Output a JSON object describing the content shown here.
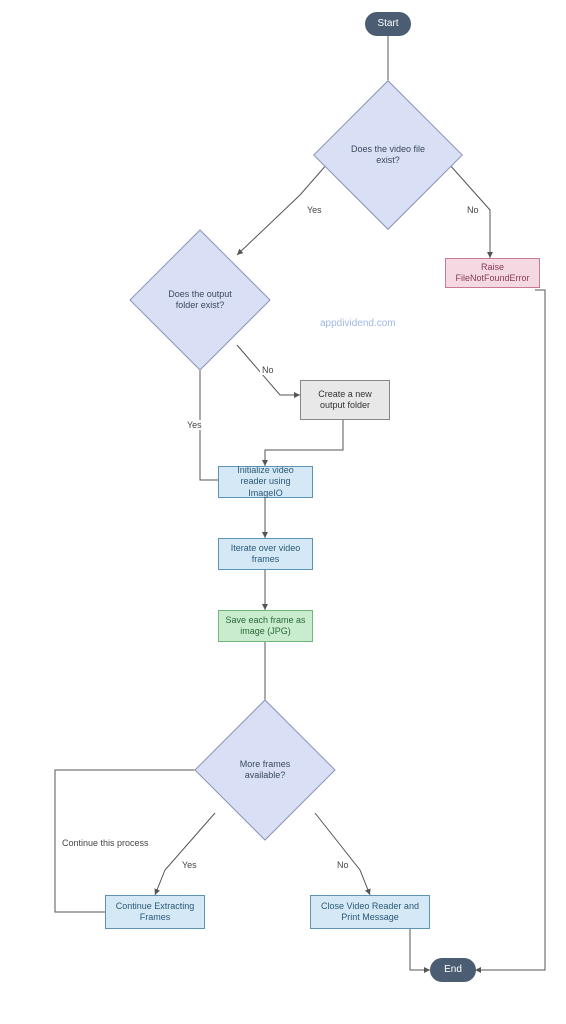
{
  "nodes": {
    "start": "Start",
    "end": "End",
    "decision_video_exists": "Does the video file exist?",
    "decision_output_exists": "Does the output folder exist?",
    "decision_more_frames": "More frames available?",
    "create_folder": "Create a new output folder",
    "raise_error": "Raise FileNotFoundError",
    "init_reader": "Initialize video reader using ImageIO",
    "iterate_frames": "Iterate over video frames",
    "save_frame": "Save each frame as image (JPG)",
    "continue_extract": "Continue Extracting Frames",
    "close_reader": "Close Video Reader and Print Message"
  },
  "edges": {
    "yes1": "Yes",
    "no1": "No",
    "yes2": "Yes",
    "no2": "No",
    "yes3": "Yes",
    "no3": "No",
    "continue_process": "Continue this process"
  },
  "watermark": "appdividend.com",
  "colors": {
    "terminator": "#4a5d73",
    "decision": "#d9dff5",
    "process_blue": "#d4e8f5",
    "process_green": "#c9ebce",
    "process_pink": "#f5d9e2",
    "process_gray": "#e8e8e8"
  },
  "chart_data": {
    "type": "flowchart",
    "nodes": [
      {
        "id": "start",
        "type": "terminator",
        "label": "Start"
      },
      {
        "id": "d1",
        "type": "decision",
        "label": "Does the video file exist?"
      },
      {
        "id": "d2",
        "type": "decision",
        "label": "Does the output folder exist?"
      },
      {
        "id": "err",
        "type": "process",
        "label": "Raise FileNotFoundError"
      },
      {
        "id": "mkfolder",
        "type": "process",
        "label": "Create a new output folder"
      },
      {
        "id": "init",
        "type": "process",
        "label": "Initialize video reader using ImageIO"
      },
      {
        "id": "iter",
        "type": "process",
        "label": "Iterate over video frames"
      },
      {
        "id": "save",
        "type": "process",
        "label": "Save each frame as image (JPG)"
      },
      {
        "id": "d3",
        "type": "decision",
        "label": "More frames available?"
      },
      {
        "id": "cont",
        "type": "process",
        "label": "Continue Extracting Frames"
      },
      {
        "id": "close",
        "type": "process",
        "label": "Close Video Reader and Print Message"
      },
      {
        "id": "end",
        "type": "terminator",
        "label": "End"
      }
    ],
    "edges": [
      {
        "from": "start",
        "to": "d1"
      },
      {
        "from": "d1",
        "to": "d2",
        "label": "Yes"
      },
      {
        "from": "d1",
        "to": "err",
        "label": "No"
      },
      {
        "from": "d2",
        "to": "init",
        "label": "Yes"
      },
      {
        "from": "d2",
        "to": "mkfolder",
        "label": "No"
      },
      {
        "from": "mkfolder",
        "to": "init"
      },
      {
        "from": "init",
        "to": "iter"
      },
      {
        "from": "iter",
        "to": "save"
      },
      {
        "from": "save",
        "to": "d3"
      },
      {
        "from": "d3",
        "to": "cont",
        "label": "Yes"
      },
      {
        "from": "d3",
        "to": "close",
        "label": "No"
      },
      {
        "from": "cont",
        "to": "d3",
        "label": "Continue this process"
      },
      {
        "from": "close",
        "to": "end"
      },
      {
        "from": "err",
        "to": "end"
      }
    ]
  }
}
